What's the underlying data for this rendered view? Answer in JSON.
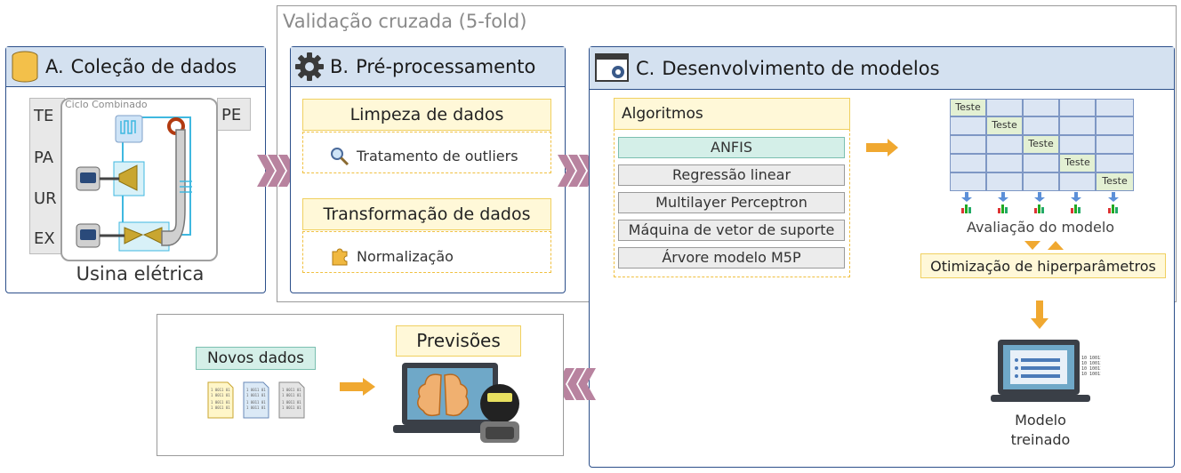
{
  "cv_title": "Validação cruzada (5-fold)",
  "panel_a": {
    "letter": "A.",
    "title": "Coleção de dados",
    "inputs": [
      "TE",
      "PA",
      "UR",
      "EX"
    ],
    "output": "PE",
    "plant_label": "Ciclo Combinado",
    "caption": "Usina elétrica"
  },
  "panel_b": {
    "letter": "B.",
    "title": "Pré-processamento",
    "cleaning_title": "Limpeza de dados",
    "cleaning_item": "Tratamento de outliers",
    "transform_title": "Transformação de dados",
    "transform_item": "Normalização"
  },
  "panel_c": {
    "letter": "C.",
    "title": "Desenvolvimento de modelos",
    "algorithms_title": "Algoritmos",
    "algorithms": [
      "ANFIS",
      "Regressão linear",
      "Multilayer Perceptron",
      "Máquina de vetor de suporte",
      "Árvore modelo M5P"
    ],
    "test_label": "Teste",
    "evaluation": "Avaliação do modelo",
    "optimization": "Otimização de hiperparâmetros",
    "trained_model": [
      "Modelo",
      "treinado"
    ]
  },
  "bottom": {
    "new_data": "Novos dados",
    "predictions": "Previsões"
  },
  "colors": {
    "panel_border": "#2c4f8a",
    "panel_header": "#d4e1f0",
    "chevron": "#b8839f",
    "orange_arrow": "#f0a830",
    "test_cell": "#e3f0d3",
    "grid_cell": "#dbe5f3"
  }
}
